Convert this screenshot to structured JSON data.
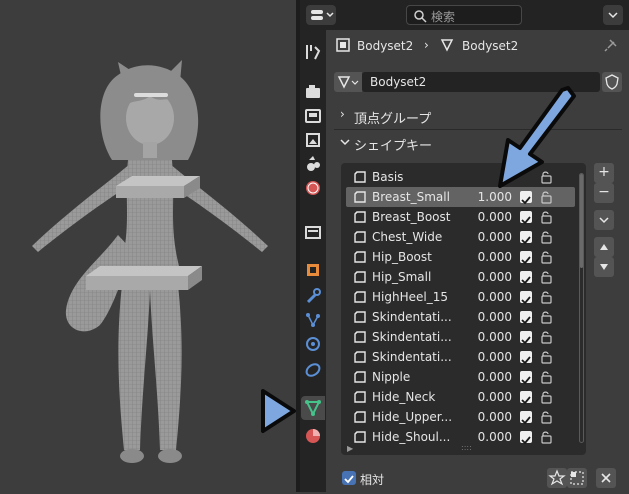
{
  "header": {
    "search_placeholder": "検索"
  },
  "breadcrumb": {
    "object": "Bodyset2",
    "mesh": "Bodyset2"
  },
  "data_block": {
    "name": "Bodyset2"
  },
  "sections": {
    "vertex_groups": "頂点グループ",
    "shape_keys": "シェイプキー"
  },
  "shape_keys": [
    {
      "name": "Basis",
      "value": ""
    },
    {
      "name": "Breast_Small",
      "value": "1.000"
    },
    {
      "name": "Breast_Boost",
      "value": "0.000"
    },
    {
      "name": "Chest_Wide",
      "value": "0.000"
    },
    {
      "name": "Hip_Boost",
      "value": "0.000"
    },
    {
      "name": "Hip_Small",
      "value": "0.000"
    },
    {
      "name": "HighHeel_15",
      "value": "0.000"
    },
    {
      "name": "Skindentati...",
      "value": "0.000"
    },
    {
      "name": "Skindentati...",
      "value": "0.000"
    },
    {
      "name": "Skindentati...",
      "value": "0.000"
    },
    {
      "name": "Nipple",
      "value": "0.000"
    },
    {
      "name": "Hide_Neck",
      "value": "0.000"
    },
    {
      "name": "Hide_Upper...",
      "value": "0.000"
    },
    {
      "name": "Hide_Shoul...",
      "value": "0.000"
    }
  ],
  "footer": {
    "relative_label": "相対"
  },
  "icons": {
    "search": "search-icon",
    "shape_key": "shape-key-icon",
    "lock": "lock-icon",
    "mesh": "mesh-data-icon"
  },
  "colors": {
    "accent": "#4772b3",
    "active_tab_icon": "#45c38a",
    "annotation_arrow": "#7ea7e0"
  }
}
